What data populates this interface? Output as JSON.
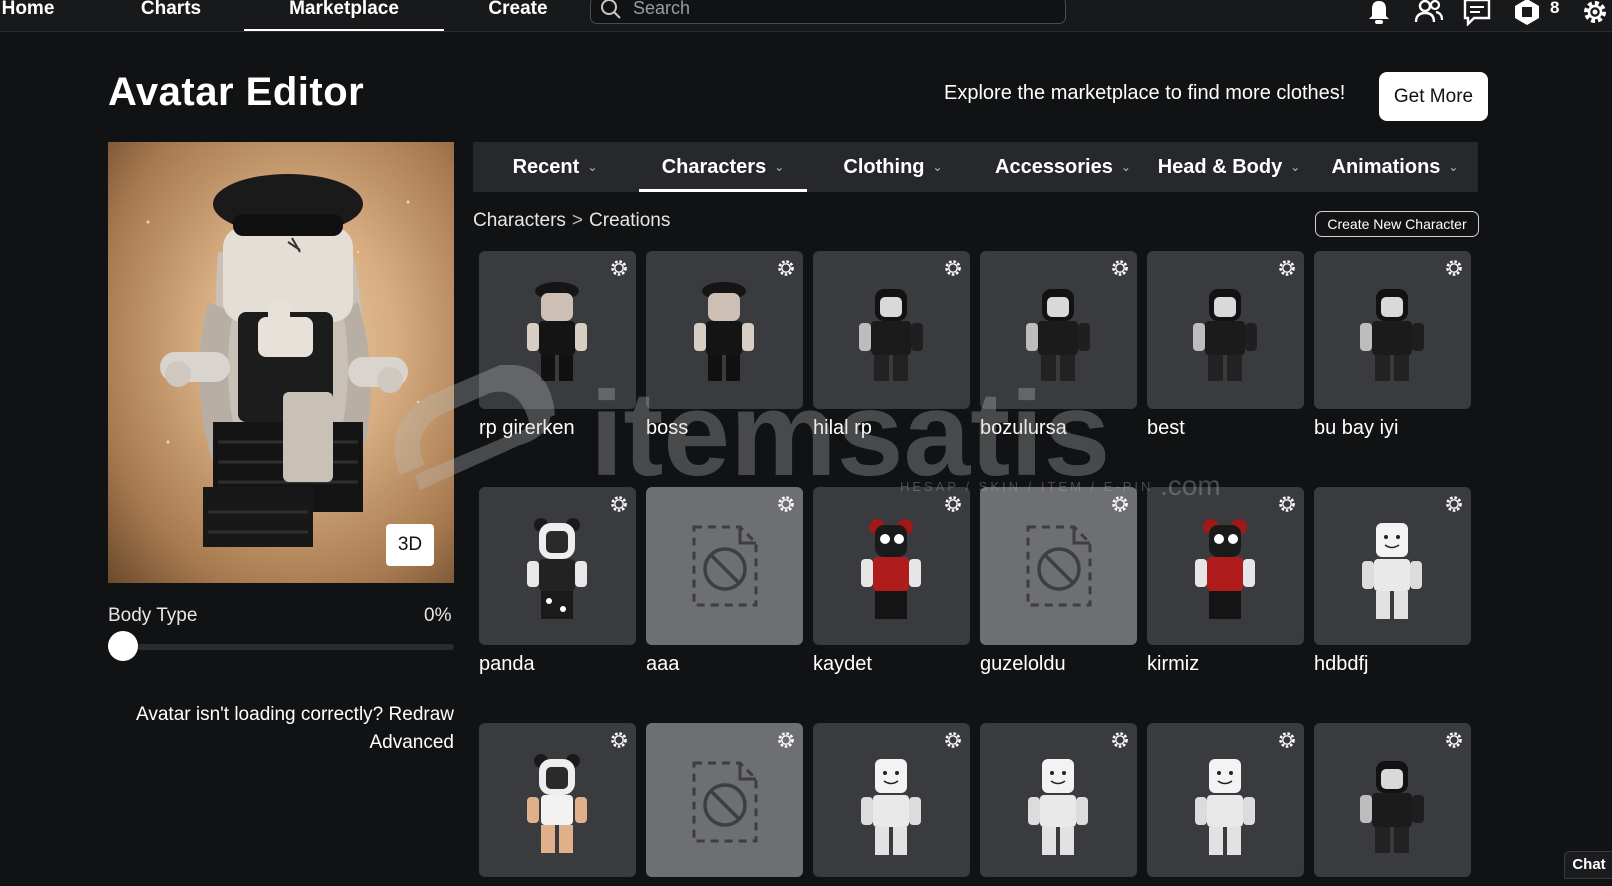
{
  "nav": {
    "home": "Home",
    "charts": "Charts",
    "marketplace": "Marketplace",
    "create": "Create",
    "search_placeholder": "Search",
    "robux": "8",
    "icons": [
      "notification-bell-icon",
      "friends-icon",
      "messages-icon",
      "robux-icon",
      "settings-gear-icon"
    ]
  },
  "header": {
    "title": "Avatar Editor",
    "promo": "Explore the marketplace to find more clothes!",
    "get_more": "Get More"
  },
  "avatar": {
    "view_button": "3D",
    "body_type_label": "Body Type",
    "body_type_value": "0%",
    "body_type_fraction": 0,
    "help_text": "Avatar isn't loading correctly? Redraw",
    "advanced": "Advanced"
  },
  "tabs": [
    {
      "label": "Recent",
      "active": false
    },
    {
      "label": "Characters",
      "active": true
    },
    {
      "label": "Clothing",
      "active": false
    },
    {
      "label": "Accessories",
      "active": false
    },
    {
      "label": "Head & Body",
      "active": false
    },
    {
      "label": "Animations",
      "active": false
    }
  ],
  "breadcrumb": {
    "parent": "Characters",
    "sep": ">",
    "current": "Creations"
  },
  "create_new": "Create New Character",
  "characters": [
    {
      "name": "rp girerken",
      "style": "beret"
    },
    {
      "name": "boss",
      "style": "beret"
    },
    {
      "name": "hilal rp",
      "style": "black"
    },
    {
      "name": "bozulursa",
      "style": "black"
    },
    {
      "name": "best",
      "style": "black"
    },
    {
      "name": "bu bay iyi",
      "style": "black"
    },
    {
      "name": "panda",
      "style": "panda"
    },
    {
      "name": "aaa",
      "style": "missing"
    },
    {
      "name": "kaydet",
      "style": "red"
    },
    {
      "name": "guzeloldu",
      "style": "missing"
    },
    {
      "name": "kirmiz",
      "style": "red"
    },
    {
      "name": "hdbdfj",
      "style": "white"
    },
    {
      "name": "",
      "style": "panda-light"
    },
    {
      "name": "",
      "style": "missing"
    },
    {
      "name": "",
      "style": "white"
    },
    {
      "name": "",
      "style": "white"
    },
    {
      "name": "",
      "style": "white"
    },
    {
      "name": "",
      "style": "black"
    }
  ],
  "watermark": {
    "brand": "itemsatis",
    "tagline": "HESAP / SKIN / ITEM / E-PIN",
    "tld": ".com"
  },
  "chat": "Chat",
  "colors": {
    "background": "#111214",
    "card": "#393b3f",
    "card_missing": "#6e6f72",
    "tabbar": "#27282b"
  }
}
